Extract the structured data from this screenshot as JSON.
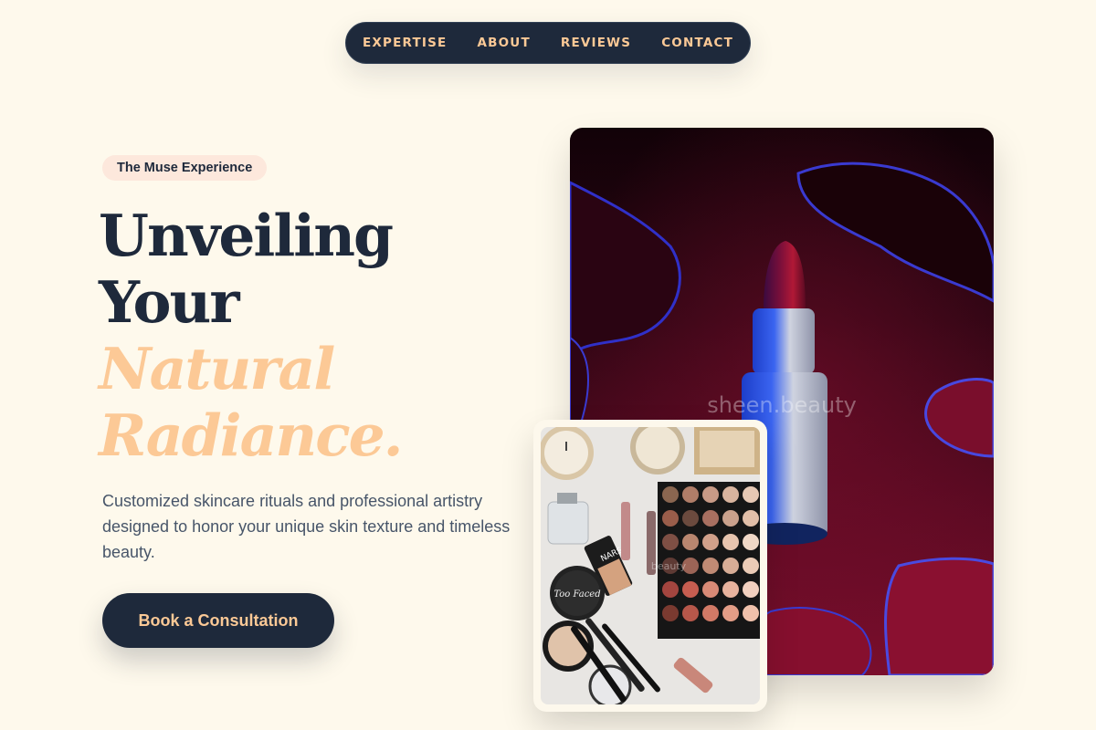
{
  "nav": {
    "items": [
      {
        "label": "EXPERTISE"
      },
      {
        "label": "ABOUT"
      },
      {
        "label": "REVIEWS"
      },
      {
        "label": "CONTACT"
      }
    ]
  },
  "hero": {
    "badge": "The Muse Experience",
    "headline_line1": "Unveiling",
    "headline_line2": "Your",
    "headline_line3": "Natural",
    "headline_line4": "Radiance.",
    "description": "Customized skincare rituals and professional artistry designed to honor your unique skin texture and timeless beauty.",
    "cta_label": "Book a Consultation"
  },
  "images": {
    "main_watermark": "sheen.beauty",
    "small_watermark": "beauty",
    "compact_label_1": "Too Faced",
    "compact_label_2": "NARS"
  },
  "colors": {
    "background": "#fef9ec",
    "navy": "#1e293b",
    "accent_peach": "#fcc996",
    "badge_bg": "#fde8dc",
    "body_text": "#475569"
  }
}
